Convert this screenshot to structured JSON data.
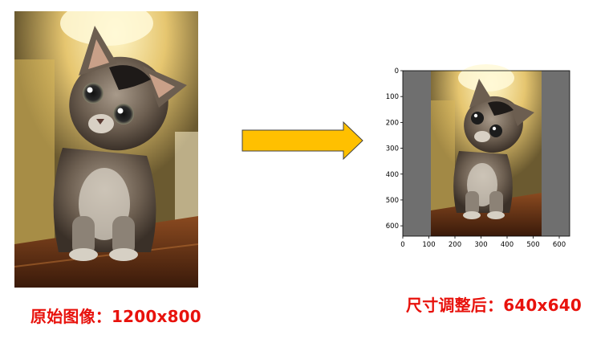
{
  "captions": {
    "original": "原始图像：1200x800",
    "resized": "尺寸调整后：640x640"
  },
  "plot": {
    "x_ticks": [
      "0",
      "100",
      "200",
      "300",
      "400",
      "500",
      "600"
    ],
    "y_ticks": [
      "0",
      "100",
      "200",
      "300",
      "400",
      "500",
      "600"
    ],
    "xlim": [
      0,
      640
    ],
    "ylim": [
      0,
      640
    ],
    "padding": {
      "color": "#6f6f6f",
      "left": [
        0,
        107
      ],
      "right": [
        533,
        640
      ]
    }
  },
  "colors": {
    "caption": "#e8120c",
    "arrow_fill": "#ffc000",
    "arrow_stroke": "#404040",
    "padding_gray": "#6f6f6f"
  },
  "icons": {
    "arrow": "right-arrow-icon"
  }
}
